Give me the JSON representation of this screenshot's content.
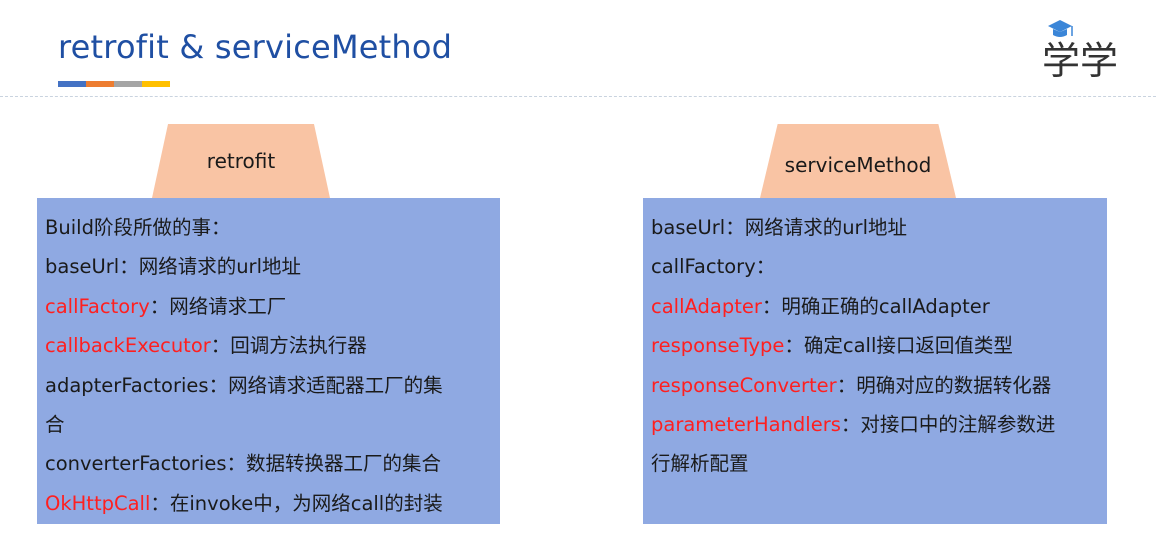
{
  "title": "retrofit & serviceMethod",
  "accent_colors": [
    "#4472c4",
    "#ed7d31",
    "#a5a5a5",
    "#ffc000"
  ],
  "logo": {
    "icon": "graduation-cap-icon",
    "text": "学学"
  },
  "retrofit": {
    "tab": "retrofit",
    "lines": [
      {
        "key": "Build阶段所做的事：",
        "desc": "",
        "highlight": false
      },
      {
        "key": "baseUrl",
        "desc": "：网络请求的url地址",
        "highlight": false
      },
      {
        "key": "callFactory",
        "desc": "：网络请求工厂",
        "highlight": true
      },
      {
        "key": "callbackExecutor",
        "desc": "：回调方法执行器",
        "highlight": true
      },
      {
        "key": "adapterFactories",
        "desc": "：网络请求适配器工厂的集",
        "highlight": false
      },
      {
        "key": "合",
        "desc": "",
        "highlight": false
      },
      {
        "key": "converterFactories",
        "desc": "：数据转换器工厂的集合",
        "highlight": false
      },
      {
        "key": "OkHttpCall",
        "desc": "：在invoke中，为网络call的封装",
        "highlight": true
      }
    ]
  },
  "service_method": {
    "tab": "serviceMethod",
    "lines": [
      {
        "key": "baseUrl",
        "desc": "：网络请求的url地址",
        "highlight": false
      },
      {
        "key": "callFactory",
        "desc": "：",
        "highlight": false
      },
      {
        "key": "callAdapter",
        "desc": "：明确正确的callAdapter",
        "highlight": true
      },
      {
        "key": "responseType",
        "desc": "：确定call接口返回值类型",
        "highlight": true
      },
      {
        "key": "responseConverter",
        "desc": "：明确对应的数据转化器",
        "highlight": true
      },
      {
        "key": "parameterHandlers",
        "desc": "：对接口中的注解参数进",
        "highlight": true
      },
      {
        "key": "行解析配置",
        "desc": "",
        "highlight": false
      }
    ]
  },
  "colors": {
    "title": "#1f4fa3",
    "panel": "#8fa9e2",
    "tab": "#f9c4a4",
    "highlight": "#ff1f1f"
  }
}
